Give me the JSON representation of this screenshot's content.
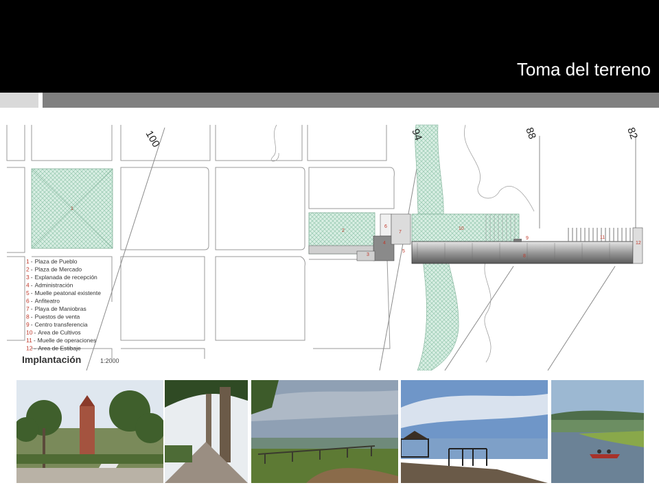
{
  "slide": {
    "title": "Toma del terreno"
  },
  "plan": {
    "caption": "Implantación",
    "scale": "1:2000",
    "street_numbers": [
      "100",
      "94",
      "88",
      "82"
    ],
    "zone_numbers": [
      "1",
      "2",
      "3",
      "4",
      "5",
      "6",
      "7",
      "8",
      "9",
      "10",
      "11",
      "12"
    ],
    "legend": [
      {
        "num": "1",
        "label": "Plaza de Pueblo"
      },
      {
        "num": "2",
        "label": "Plaza de Mercado"
      },
      {
        "num": "3",
        "label": "Explanada de recepción"
      },
      {
        "num": "4",
        "label": "Administración"
      },
      {
        "num": "5",
        "label": "Muelle peatonal existente"
      },
      {
        "num": "6",
        "label": "Anfiteatro"
      },
      {
        "num": "7",
        "label": "Playa de Maniobras"
      },
      {
        "num": "8",
        "label": "Puestos de venta"
      },
      {
        "num": "9",
        "label": "Centro transferencia"
      },
      {
        "num": "10",
        "label": "Area de Cultivos"
      },
      {
        "num": "11",
        "label": "Muelle de operaciones"
      },
      {
        "num": "12",
        "label": "Area de Estibaje"
      }
    ]
  },
  "colors": {
    "header": "#000000",
    "title_text": "#ffffff",
    "bar_light": "#d9d9d9",
    "bar_dark": "#808080",
    "plaza_green": "#cfe8dc",
    "zone_number_red": "#c0392b"
  },
  "photos": [
    {
      "subject": "town plaza with palm trees and church"
    },
    {
      "subject": "palm-lined walkway"
    },
    {
      "subject": "wooden pier over wetland"
    },
    {
      "subject": "pier with gazebo at sunset over lake"
    },
    {
      "subject": "boat on river with green hills"
    }
  ]
}
